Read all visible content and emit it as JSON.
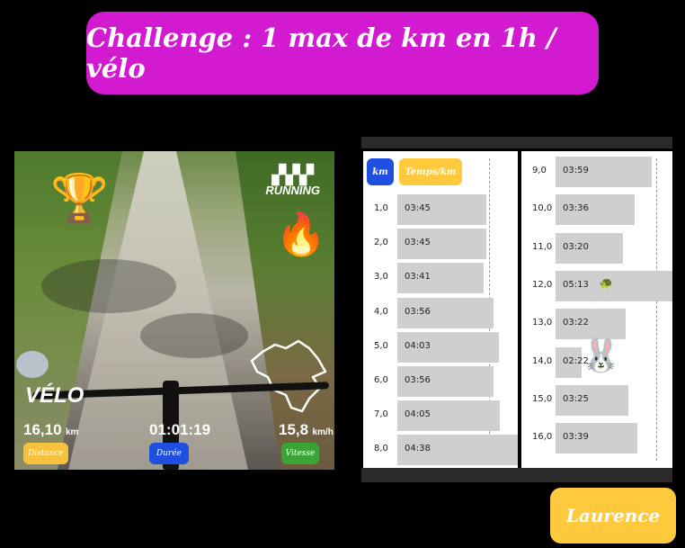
{
  "title": "Challenge : 1 max de km en 1h / vélo",
  "activity": {
    "brand_name": "RUNNING",
    "brand_icon": "adidas-stripes",
    "sport": "VÉLO",
    "distance_value": "16,10",
    "distance_unit": "km",
    "distance_label": "Distance",
    "duration_value": "01:01:19",
    "duration_label": "Durée",
    "speed_value": "15,8",
    "speed_unit": "km/h",
    "speed_label": "Vitesse",
    "colors": {
      "distance": "#f6c23e",
      "duration": "#1f4fe0",
      "speed": "#3aa335"
    }
  },
  "splits": {
    "header_km": "km",
    "header_time": "Temps/km",
    "header_colors": {
      "km": "#1f4fe0",
      "time": "#fec93c"
    },
    "left": [
      {
        "km": "1,0",
        "time": "03:45",
        "fraction": 0.74
      },
      {
        "km": "2,0",
        "time": "03:45",
        "fraction": 0.74
      },
      {
        "km": "3,0",
        "time": "03:41",
        "fraction": 0.72
      },
      {
        "km": "4,0",
        "time": "03:56",
        "fraction": 0.8
      },
      {
        "km": "5,0",
        "time": "04:03",
        "fraction": 0.84
      },
      {
        "km": "6,0",
        "time": "03:56",
        "fraction": 0.8
      },
      {
        "km": "7,0",
        "time": "04:05",
        "fraction": 0.85
      },
      {
        "km": "8,0",
        "time": "04:38",
        "fraction": 1.0
      }
    ],
    "right": [
      {
        "km": "9,0",
        "time": "03:59",
        "fraction": 0.82
      },
      {
        "km": "10,0",
        "time": "03:36",
        "fraction": 0.68
      },
      {
        "km": "11,0",
        "time": "03:20",
        "fraction": 0.58
      },
      {
        "km": "12,0",
        "time": "05:13",
        "fraction": 1.0
      },
      {
        "km": "13,0",
        "time": "03:22",
        "fraction": 0.6
      },
      {
        "km": "14,0",
        "time": "02:22",
        "fraction": 0.22
      },
      {
        "km": "15,0",
        "time": "03:25",
        "fraction": 0.62
      },
      {
        "km": "16,0",
        "time": "03:39",
        "fraction": 0.7
      }
    ],
    "slowest_icon": "turtle-icon",
    "fastest_icon": "rabbit-icon"
  },
  "participant": "Laurence",
  "colors": {
    "title_bg": "#d21bd0",
    "name_bg": "#fec93c"
  }
}
